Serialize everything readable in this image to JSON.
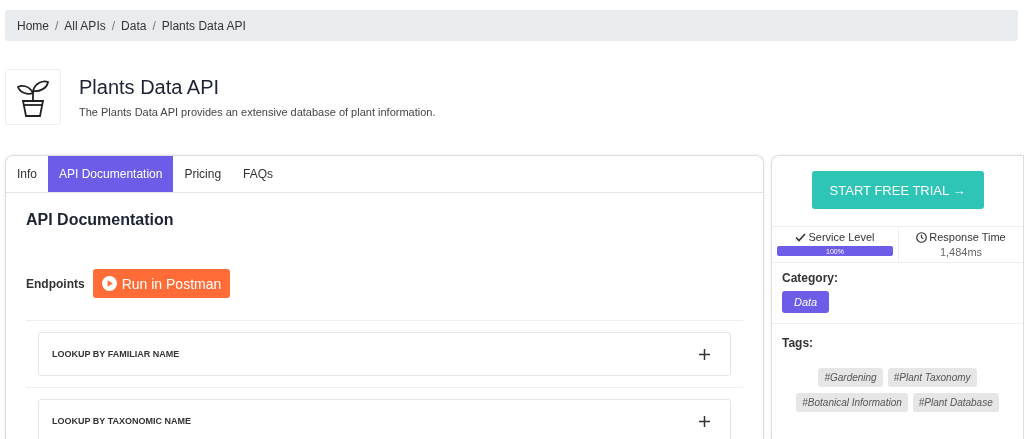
{
  "breadcrumb": [
    "Home",
    "All APIs",
    "Data",
    "Plants Data API"
  ],
  "breadcrumb_separator": "/",
  "api": {
    "title": "Plants Data API",
    "description": "The Plants Data API provides an extensive database of plant information."
  },
  "tabs": [
    {
      "label": "Info",
      "selected": false
    },
    {
      "label": "API Documentation",
      "selected": true
    },
    {
      "label": "Pricing",
      "selected": false
    },
    {
      "label": "FAQs",
      "selected": false
    }
  ],
  "doc": {
    "heading": "API Documentation",
    "endpoints_label": "Endpoints",
    "postman_button": "Run in Postman"
  },
  "endpoints": [
    {
      "name": "LOOKUP BY FAMILIAR NAME",
      "expanded": false
    },
    {
      "name": "LOOKUP BY TAXONOMIC NAME",
      "expanded": false
    }
  ],
  "sidebar": {
    "trial_button": "START FREE TRIAL →",
    "service_level": {
      "label": "Service Level",
      "level": 1,
      "reading": "100%"
    },
    "response_time": {
      "label": "Response Time",
      "value": "1,484ms"
    },
    "category_label": "Category:",
    "category": "Data",
    "tags_label": "Tags:",
    "tags": [
      "#Gardening",
      "#Plant Taxonomy",
      "#Botanical Information",
      "#Plant Database"
    ]
  }
}
